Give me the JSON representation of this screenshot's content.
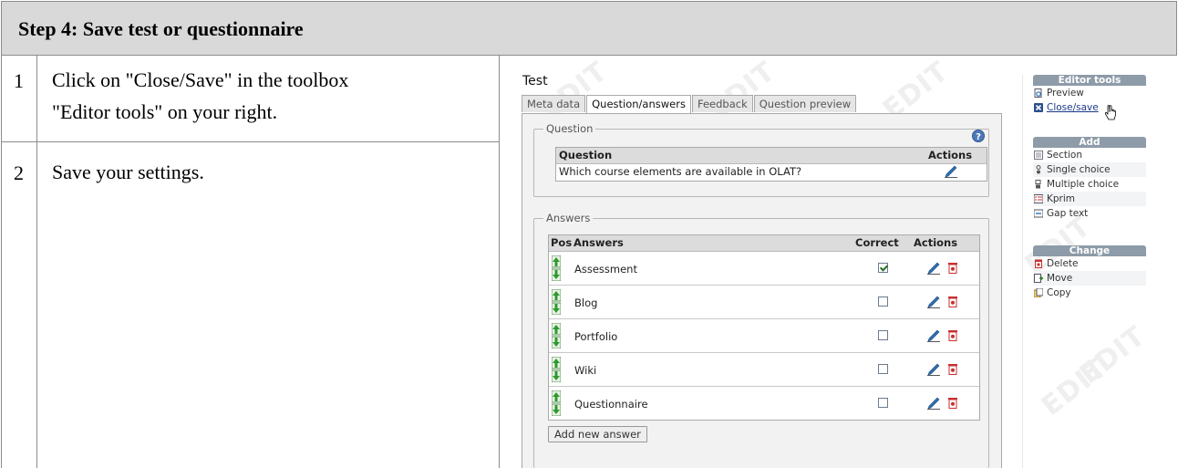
{
  "header": {
    "title": "Step 4: Save test or questionnaire"
  },
  "steps": [
    {
      "num": "1",
      "line1": "Click on \"Close/Save\" in the toolbox",
      "line2": "\"Editor tools\" on your right."
    },
    {
      "num": "2",
      "line1": "Save your settings."
    }
  ],
  "screenshot": {
    "watermark": "EDIT",
    "title": "Test",
    "tabs": [
      "Meta data",
      "Question/answers",
      "Feedback",
      "Question preview"
    ],
    "active_tab": "Question/answers",
    "question_group": {
      "legend": "Question",
      "headers": {
        "question": "Question",
        "actions": "Actions"
      },
      "question_text": "Which course elements are available in OLAT?"
    },
    "answers_group": {
      "legend": "Answers",
      "headers": {
        "pos": "Pos",
        "answers": "Answers",
        "correct": "Correct",
        "actions": "Actions"
      },
      "rows": [
        {
          "label": "Assessment",
          "correct": true
        },
        {
          "label": "Blog",
          "correct": false
        },
        {
          "label": "Portfolio",
          "correct": false
        },
        {
          "label": "Wiki",
          "correct": false
        },
        {
          "label": "Questionnaire",
          "correct": false
        }
      ],
      "add_button": "Add new answer"
    },
    "editor_tools": {
      "title": "Editor tools",
      "items": [
        {
          "label": "Preview",
          "icon": "preview-icon"
        },
        {
          "label": "Close/save",
          "icon": "close-save-icon"
        }
      ]
    },
    "add_box": {
      "title": "Add",
      "items": [
        {
          "label": "Section",
          "icon": "section-icon"
        },
        {
          "label": "Single choice",
          "icon": "single-choice-icon"
        },
        {
          "label": "Multiple choice",
          "icon": "multiple-choice-icon"
        },
        {
          "label": "Kprim",
          "icon": "kprim-icon"
        },
        {
          "label": "Gap text",
          "icon": "gap-text-icon"
        }
      ]
    },
    "change_box": {
      "title": "Change",
      "items": [
        {
          "label": "Delete",
          "icon": "delete-icon"
        },
        {
          "label": "Move",
          "icon": "move-icon"
        },
        {
          "label": "Copy",
          "icon": "copy-icon"
        }
      ]
    },
    "colors": {
      "header_bg": "#d9d9d9",
      "toolbox_header": "#8e9ba8",
      "table_head": "#dcdcdc",
      "panel_bg": "#f2f2f2",
      "link_blue": "#1a3a8a"
    }
  }
}
